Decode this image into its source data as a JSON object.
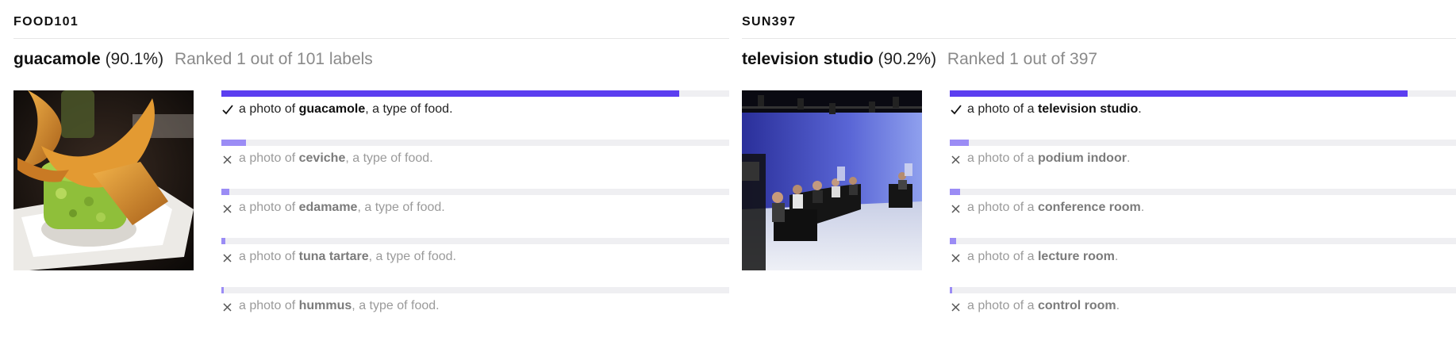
{
  "panels": [
    {
      "dataset": "FOOD101",
      "top_label": "guacamole",
      "top_percent": "(90.1%)",
      "rank_text": "Ranked 1 out of 101 labels",
      "image_subject": "guacamole with plantain chips",
      "results": [
        {
          "prefix": "a photo of ",
          "label": "guacamole",
          "suffix": ", a type of food.",
          "score": 0.901,
          "correct": true
        },
        {
          "prefix": "a photo of ",
          "label": "ceviche",
          "suffix": ", a type of food.",
          "score": 0.048,
          "correct": false
        },
        {
          "prefix": "a photo of ",
          "label": "edamame",
          "suffix": ", a type of food.",
          "score": 0.015,
          "correct": false
        },
        {
          "prefix": "a photo of ",
          "label": "tuna tartare",
          "suffix": ", a type of food.",
          "score": 0.008,
          "correct": false
        },
        {
          "prefix": "a photo of ",
          "label": "hummus",
          "suffix": ", a type of food.",
          "score": 0.004,
          "correct": false
        }
      ]
    },
    {
      "dataset": "SUN397",
      "top_label": "television studio",
      "top_percent": "(90.2%)",
      "rank_text": "Ranked 1 out of 397",
      "image_subject": "television studio panel set",
      "results": [
        {
          "prefix": "a photo of a ",
          "label": "television studio",
          "suffix": ".",
          "score": 0.902,
          "correct": true
        },
        {
          "prefix": "a photo of a ",
          "label": "podium indoor",
          "suffix": ".",
          "score": 0.038,
          "correct": false
        },
        {
          "prefix": "a photo of a ",
          "label": "conference room",
          "suffix": ".",
          "score": 0.021,
          "correct": false
        },
        {
          "prefix": "a photo of a ",
          "label": "lecture room",
          "suffix": ".",
          "score": 0.012,
          "correct": false
        },
        {
          "prefix": "a photo of a ",
          "label": "control room",
          "suffix": ".",
          "score": 0.005,
          "correct": false
        }
      ]
    }
  ],
  "chart_data": [
    {
      "type": "bar",
      "title": "FOOD101",
      "categories": [
        "guacamole",
        "ceviche",
        "edamame",
        "tuna tartare",
        "hummus"
      ],
      "values": [
        0.901,
        0.048,
        0.015,
        0.008,
        0.004
      ],
      "ylim": [
        0,
        1
      ]
    },
    {
      "type": "bar",
      "title": "SUN397",
      "categories": [
        "television studio",
        "podium indoor",
        "conference room",
        "lecture room",
        "control room"
      ],
      "values": [
        0.902,
        0.038,
        0.021,
        0.012,
        0.005
      ],
      "ylim": [
        0,
        1
      ]
    }
  ],
  "colors": {
    "top_bar": "#5b3ef0",
    "other_bar": "#9b8cf5",
    "track": "#efeff2",
    "muted_text": "#9a9a9a"
  },
  "icons": {
    "correct": "check-icon",
    "incorrect": "close-icon"
  }
}
